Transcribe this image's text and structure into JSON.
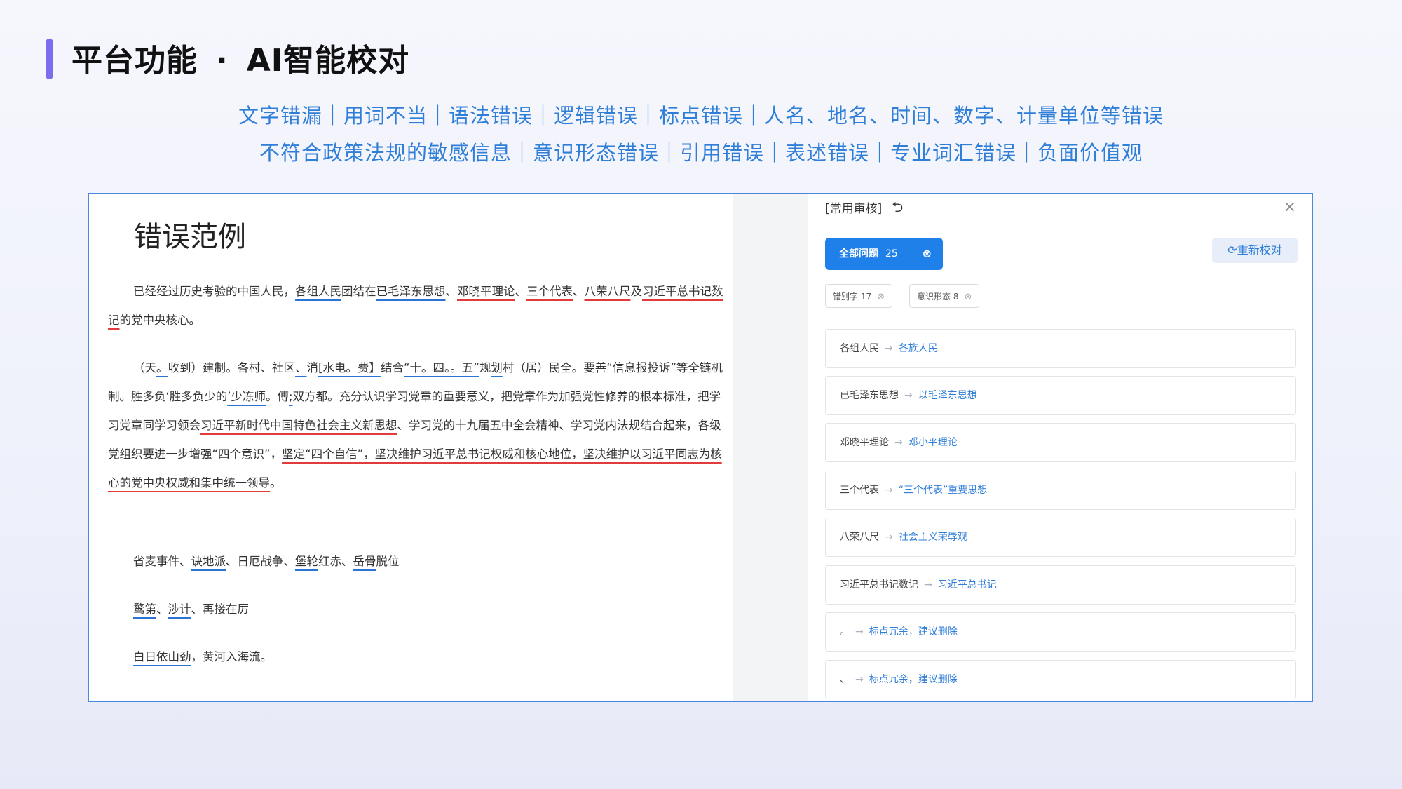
{
  "header": {
    "title_left": "平台功能",
    "title_sep": "·",
    "title_right": "AI智能校对",
    "tags_line1": "文字错漏｜用词不当｜语法错误｜逻辑错误｜标点错误｜人名、地名、时间、数字、计量单位等错误",
    "tags_line2": "不符合政策法规的敏感信息｜意识形态错误｜引用错误｜表述错误｜专业词汇错误｜负面价值观"
  },
  "document": {
    "title": "错误范例",
    "p1": {
      "s1": "已经经过历史考验的中国人民，",
      "e1": "各组人民",
      "s2": "团结在",
      "e2": "已毛泽东思想",
      "s3": "、",
      "e3": "邓晓平理论",
      "s4": "、",
      "e4": "三个代表",
      "s5": "、",
      "e5": "八荣八尺",
      "s6": "及",
      "e6": "习近平总书记数记",
      "s7": "的党中央核心。"
    },
    "p2": {
      "s1": "（天",
      "e1": "。",
      "s2": "收到）建制。各村、社区",
      "e2": "、",
      "s3": "消",
      "e3": "[水电。费】",
      "s4": "结合",
      "e4": "“十。四。。五”",
      "s5": "规",
      "e5": "划",
      "s6": "村（居）民全。要善“信息报投诉”等全链机制。胜多负‘胜多负少的",
      "e6": "’少冻师",
      "s7": "。傅",
      "e7": ";",
      "s8": "双方都。充分认识学习党章的重要意义，把党章作为加强党性修养的根本标准，把学习党章同学习领会",
      "e8": "习近平新时代中国特色社会主义新思想",
      "s9": "、学习党的十九届五中全会精神、学习党内法规结合起来，各级党组织要进一步增强“四个意识”，",
      "e9": "坚定“四个自信”，坚决维护习近平总书记权威和核心地位，坚决维护以习近平同志为核心的党中央权威和集中统一领导",
      "s10": "。"
    },
    "p3": {
      "s1": "省麦事件、",
      "e1": "诀地派",
      "s2": "、日厄战争、",
      "e2": "堡轮",
      "s3": "红赤、",
      "e3": "岳骨",
      "s4": "脱位"
    },
    "p4": {
      "e1": "鹜第",
      "s1": "、",
      "e2": "涉计",
      "s2": "、再接在厉"
    },
    "p5": {
      "e1": "白日依山劲",
      "s1": "，黄河入海流。"
    }
  },
  "panel": {
    "header": "[常用审核]",
    "close": "×",
    "all_label": "全部问题",
    "all_count": "25",
    "recheck_label": "重新校对",
    "chips": [
      {
        "label": "错别字",
        "count": "17"
      },
      {
        "label": "意识形态",
        "count": "8"
      }
    ],
    "items": [
      {
        "original": "各组人民",
        "suggestion": "各族人民"
      },
      {
        "original": "已毛泽东思想",
        "suggestion": "以毛泽东思想"
      },
      {
        "original": "邓晓平理论",
        "suggestion": "邓小平理论"
      },
      {
        "original": "三个代表",
        "suggestion": "“三个代表”重要思想"
      },
      {
        "original": "八荣八尺",
        "suggestion": "社会主义荣辱观"
      },
      {
        "original": "习近平总书记数记",
        "suggestion": "习近平总书记"
      },
      {
        "original": "。",
        "suggestion": "标点冗余，建议删除"
      },
      {
        "original": "、",
        "suggestion": "标点冗余，建议删除"
      }
    ]
  }
}
